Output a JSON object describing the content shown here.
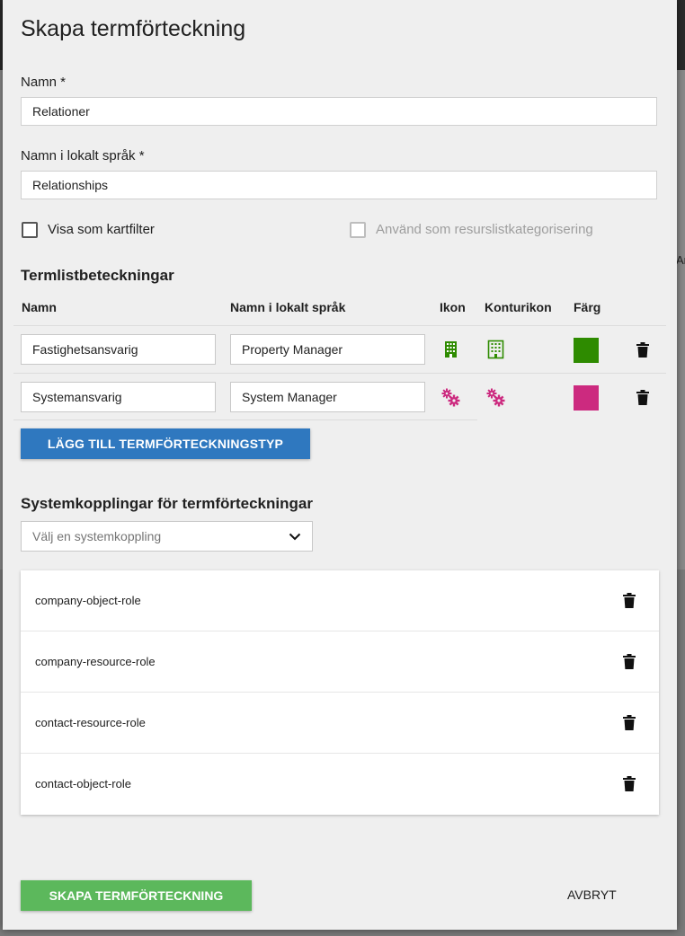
{
  "dialog": {
    "title": "Skapa termförteckning"
  },
  "form": {
    "name_label": "Namn *",
    "name_value": "Relationer",
    "local_name_label": "Namn i lokalt språk *",
    "local_name_value": "Relationships",
    "show_as_map_filter_label": "Visa som kartfilter",
    "show_as_map_filter_checked": false,
    "use_as_resource_category_label": "Använd som resurslistkategorisering",
    "use_as_resource_category_checked": false,
    "use_as_resource_category_disabled": true
  },
  "term_list": {
    "heading": "Termlistbeteckningar",
    "columns": {
      "name": "Namn",
      "local_name": "Namn i lokalt språk",
      "icon": "Ikon",
      "outline_icon": "Konturikon",
      "color": "Färg"
    },
    "rows": [
      {
        "name": "Fastighetsansvarig",
        "local_name": "Property Manager",
        "icon": "building-icon",
        "outline_icon": "building-outline-icon",
        "color": "#2e8b00"
      },
      {
        "name": "Systemansvarig",
        "local_name": "System Manager",
        "icon": "cogs-icon",
        "outline_icon": "cogs-icon",
        "color": "#cc2a7f"
      }
    ],
    "add_button_label": "LÄGG TILL TERMFÖRTECKNINGSTYP"
  },
  "system_links": {
    "heading": "Systemkopplingar för termförteckningar",
    "select_placeholder": "Välj en systemkoppling",
    "items": [
      "company-object-role",
      "company-resource-role",
      "contact-resource-role",
      "contact-object-role"
    ]
  },
  "actions": {
    "create_label": "SKAPA TERMFÖRTECKNING",
    "cancel_label": "AVBRYT"
  },
  "background": {
    "peek_text": "Ar"
  },
  "colors": {
    "primary_button": "#2f78bf",
    "create_button": "#5cb85c",
    "icon_green": "#2e8b00",
    "icon_magenta": "#cc2a7f"
  }
}
